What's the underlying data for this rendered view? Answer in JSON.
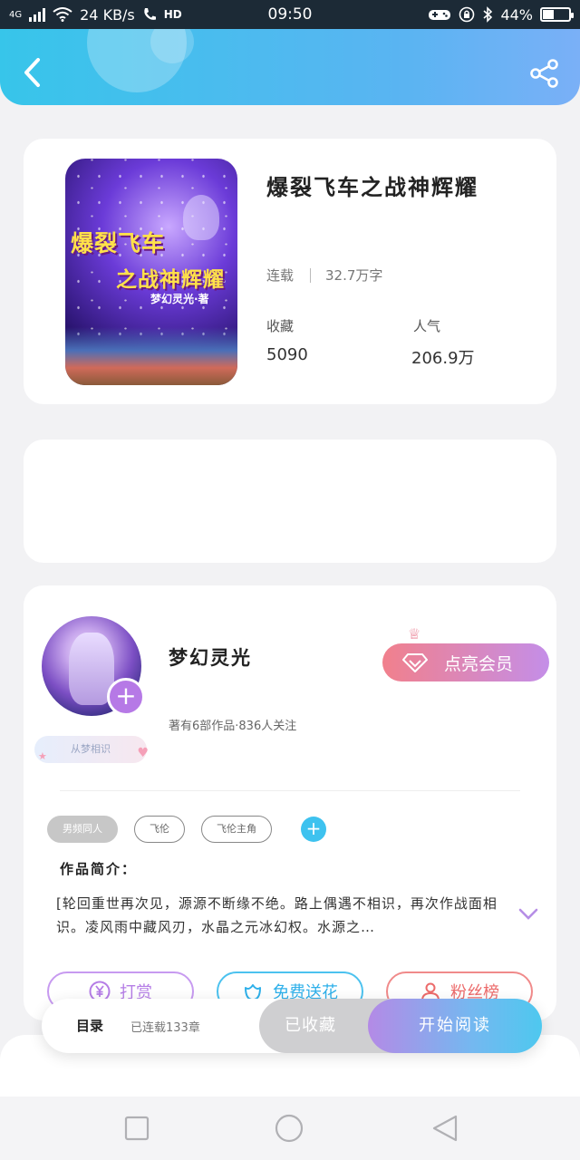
{
  "status_bar": {
    "network": "4G",
    "speed": "24 KB/s",
    "hd": "HD",
    "time": "09:50",
    "battery": "44%",
    "battery_level": 0.44
  },
  "header": {
    "back_icon": "chevron-left-icon",
    "share_icon": "share-icon"
  },
  "book": {
    "title": "爆裂飞车之战神辉耀",
    "cover": {
      "title_line1": "爆裂飞车",
      "title_line2": "之战神辉耀",
      "author_line": "梦幻灵光·著"
    },
    "status": "连载",
    "word_count": "32.7万字",
    "favorites_label": "收藏",
    "favorites_value": "5090",
    "popularity_label": "人气",
    "popularity_value": "206.9万"
  },
  "author": {
    "name": "梦幻灵光",
    "meta": "著有6部作品·836人关注",
    "follow_plus": "+",
    "badge": "从梦相识",
    "vip_button": "点亮会员"
  },
  "tags": {
    "items": [
      "男频同人",
      "飞伦",
      "飞伦主角"
    ],
    "add": "+"
  },
  "intro": {
    "heading": "作品简介：",
    "text": "[轮回重世再次见，源源不断缘不绝。路上偶遇不相识，再次作战面相识。凌风雨中藏风刃，水晶之元冰幻权。水源之…"
  },
  "actions": {
    "tip": "打赏",
    "flower": "免费送花",
    "fans": "粉丝榜"
  },
  "bottom_bar": {
    "catalog": "目录",
    "chapters": "已连载133章",
    "collected": "已收藏",
    "start_reading": "开始阅读"
  },
  "colors": {
    "header_start": "#37c5ea",
    "header_end": "#7ab0f7",
    "vip_start": "#f1808c",
    "vip_end": "#c48ee8",
    "accent_blue": "#3ec2ef"
  }
}
